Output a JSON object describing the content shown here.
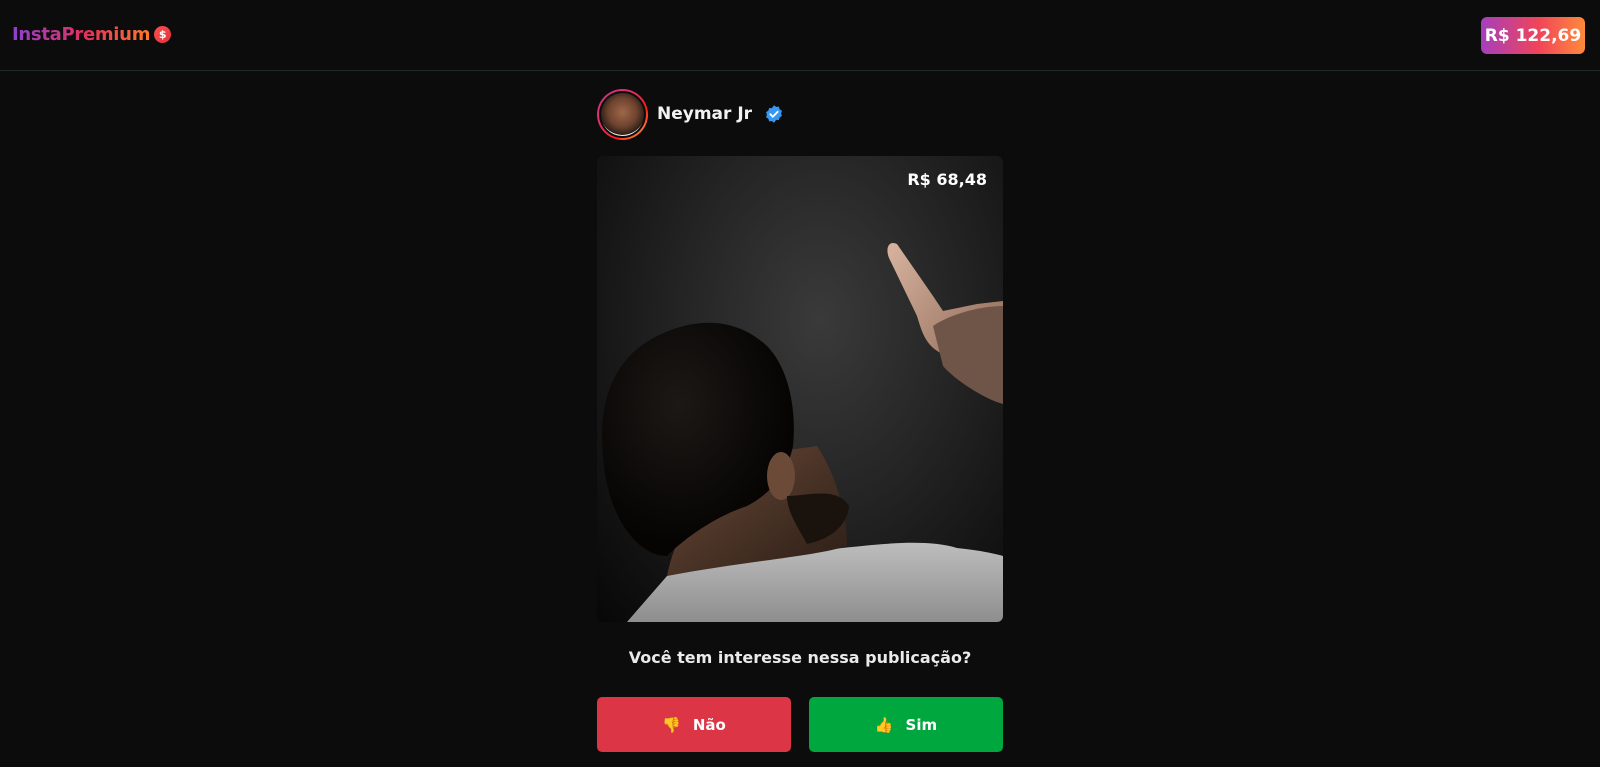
{
  "header": {
    "logo_text": "InstaPremium",
    "logo_coin_symbol": "$",
    "balance": "R$ 122,69"
  },
  "profile": {
    "username": "Neymar Jr",
    "verified": true
  },
  "post": {
    "price": "R$ 68,48",
    "question": "Você tem interesse nessa publicação?"
  },
  "actions": {
    "no_label": "Não",
    "no_icon": "thumbs-down-icon",
    "no_emoji": "👎",
    "yes_label": "Sim",
    "yes_icon": "thumbs-up-icon",
    "yes_emoji": "👍"
  },
  "colors": {
    "background": "#0c0c0c",
    "no_button": "#dc3545",
    "yes_button": "#00a63e",
    "verified_badge": "#3897f0"
  }
}
